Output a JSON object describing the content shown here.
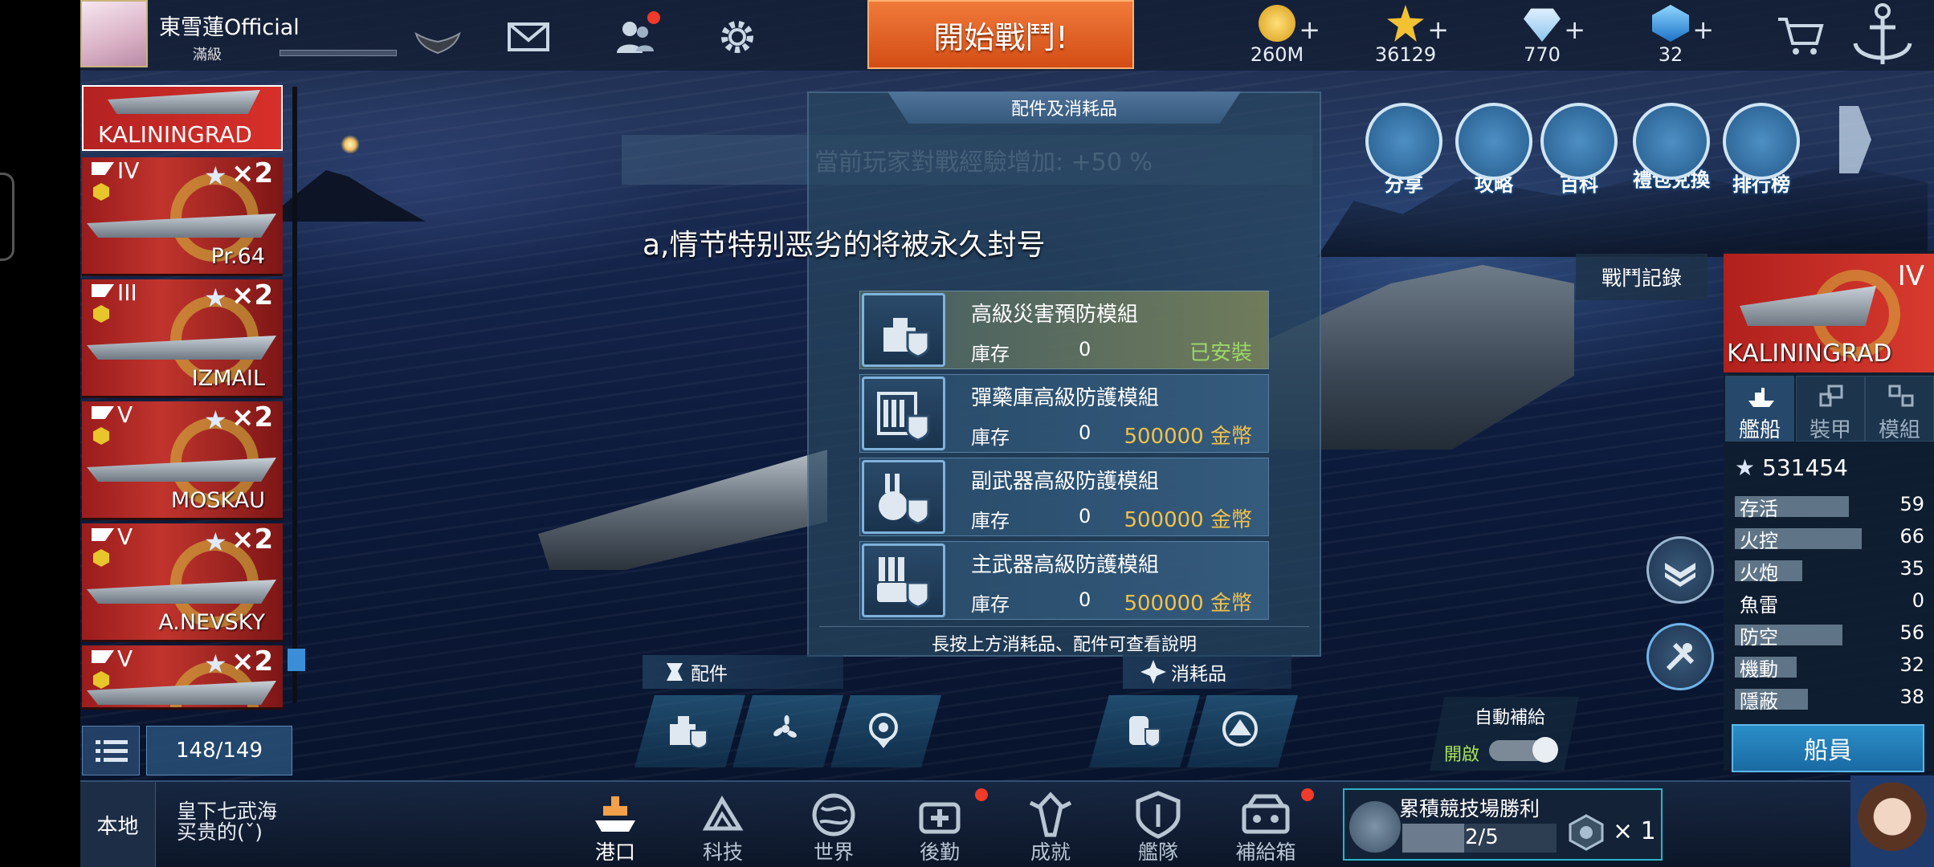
{
  "player": {
    "name": "東雪蓮Official",
    "level": "滿級"
  },
  "start_battle": "開始戰鬥!",
  "resources": [
    {
      "icon": "gold-coin-icon",
      "value": "260M"
    },
    {
      "icon": "merit-star-icon",
      "value": "36129"
    },
    {
      "icon": "diamond-icon",
      "value": "770"
    },
    {
      "icon": "blue-crystal-icon",
      "value": "32"
    }
  ],
  "ship_list": {
    "selected": "KALININGRAD",
    "ships": [
      {
        "tier": "IV",
        "mult": "×2",
        "name": "Pr.64"
      },
      {
        "tier": "III",
        "mult": "×2",
        "name": "IZMAIL"
      },
      {
        "tier": "V",
        "mult": "×2",
        "name": "MOSKAU"
      },
      {
        "tier": "V",
        "mult": "×2",
        "name": "A.NEVSKY"
      },
      {
        "tier": "V",
        "mult": "×2",
        "name": ""
      }
    ],
    "count": "148/149"
  },
  "panel": {
    "title": "配件及消耗品",
    "exp_bonus": "當前玩家對戰經驗增加:  +50 %",
    "warning": "a,情节特别恶劣的将被永久封号",
    "items": [
      {
        "name": "高級災害預防模組",
        "stock_label": "庫存",
        "stock": "0",
        "price": "",
        "status": "已安裝"
      },
      {
        "name": "彈藥庫高級防護模組",
        "stock_label": "庫存",
        "stock": "0",
        "price": "500000 金幣",
        "status": ""
      },
      {
        "name": "副武器高級防護模組",
        "stock_label": "庫存",
        "stock": "0",
        "price": "500000 金幣",
        "status": ""
      },
      {
        "name": "主武器高級防護模組",
        "stock_label": "庫存",
        "stock": "0",
        "price": "500000 金幣",
        "status": ""
      }
    ],
    "hint": "長按上方消耗品、配件可查看說明",
    "accessories_tab": "配件",
    "consumables_tab": "消耗品"
  },
  "auto_supply": {
    "label": "自動補給",
    "state": "開啟"
  },
  "quick_menu": [
    {
      "label": "分享"
    },
    {
      "label": "攻略"
    },
    {
      "label": "百科"
    },
    {
      "label": "禮包兌換"
    },
    {
      "label": "排行榜"
    }
  ],
  "battle_log": "戰鬥記錄",
  "ship_info": {
    "tier": "IV",
    "name": "KALININGRAD",
    "tabs": [
      "艦船",
      "裝甲",
      "模組"
    ],
    "score": "531454",
    "stats": [
      {
        "label": "存活",
        "value": 59
      },
      {
        "label": "火控",
        "value": 66
      },
      {
        "label": "火炮",
        "value": 35
      },
      {
        "label": "魚雷",
        "value": 0
      },
      {
        "label": "防空",
        "value": 56
      },
      {
        "label": "機動",
        "value": 32
      },
      {
        "label": "隱蔽",
        "value": 38
      }
    ],
    "crew_button": "船員"
  },
  "bottom": {
    "local": "本地",
    "chat": [
      "皇下七武海",
      "买贵的(ˇ)"
    ],
    "nav": [
      {
        "label": "港口",
        "icon": "harbor-icon"
      },
      {
        "label": "科技",
        "icon": "tech-icon"
      },
      {
        "label": "世界",
        "icon": "world-icon"
      },
      {
        "label": "後勤",
        "icon": "logistics-icon"
      },
      {
        "label": "成就",
        "icon": "achievement-icon"
      },
      {
        "label": "艦隊",
        "icon": "fleet-icon"
      },
      {
        "label": "補給箱",
        "icon": "supply-box-icon"
      }
    ],
    "arena": {
      "title": "累積競技場勝利",
      "progress": "2/5",
      "progress_fraction": 0.4,
      "reward": "× 1"
    }
  }
}
